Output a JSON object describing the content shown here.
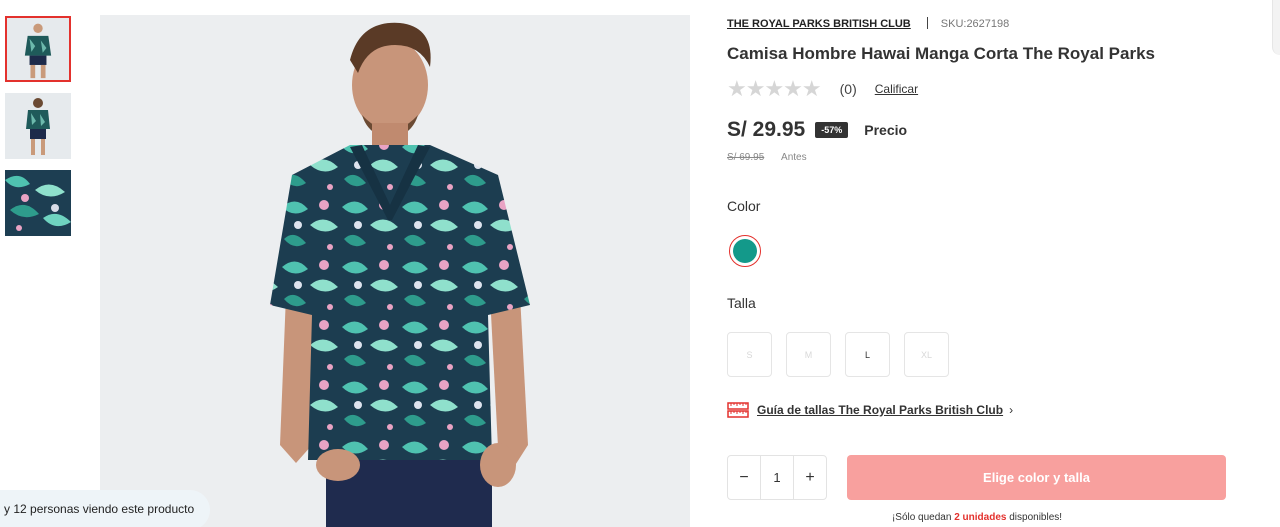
{
  "gallery": {
    "thumbnails": [
      {
        "name": "thumbnail-front-full",
        "active": true
      },
      {
        "name": "thumbnail-back-full",
        "active": false
      },
      {
        "name": "thumbnail-fabric-detail",
        "active": false
      }
    ],
    "viewers_text": "y 12 personas viendo este producto"
  },
  "product": {
    "brand": "THE ROYAL PARKS BRITISH CLUB",
    "sku": "SKU:2627198",
    "title": "Camisa Hombre Hawai Manga Corta The Royal Parks",
    "rating": {
      "stars": "★★★★★",
      "count": "(0)",
      "rate_label": "Calificar"
    },
    "price": "S/ 29.95",
    "discount_badge": "-57%",
    "price_label": "Precio",
    "old_price": "S/ 69.95",
    "old_price_label": "Antes",
    "color_label": "Color",
    "selected_color": "#13998a",
    "size_label": "Talla",
    "sizes": [
      {
        "label": "S",
        "available": false
      },
      {
        "label": "M",
        "available": false
      },
      {
        "label": "L",
        "available": true
      },
      {
        "label": "XL",
        "available": false
      }
    ],
    "size_guide": "Guía de tallas The Royal Parks British Club",
    "size_guide_chevron": "›",
    "quantity": {
      "minus": "−",
      "value": "1",
      "plus": "+"
    },
    "cta": "Elige color y talla",
    "stock": {
      "prefix": "¡Sólo quedan ",
      "units": "2 unidades",
      "suffix": " disponibles!"
    }
  },
  "colors": {
    "accent": "#e3312d",
    "cta_disabled": "#f8a09e",
    "swatch": "#13998a"
  }
}
